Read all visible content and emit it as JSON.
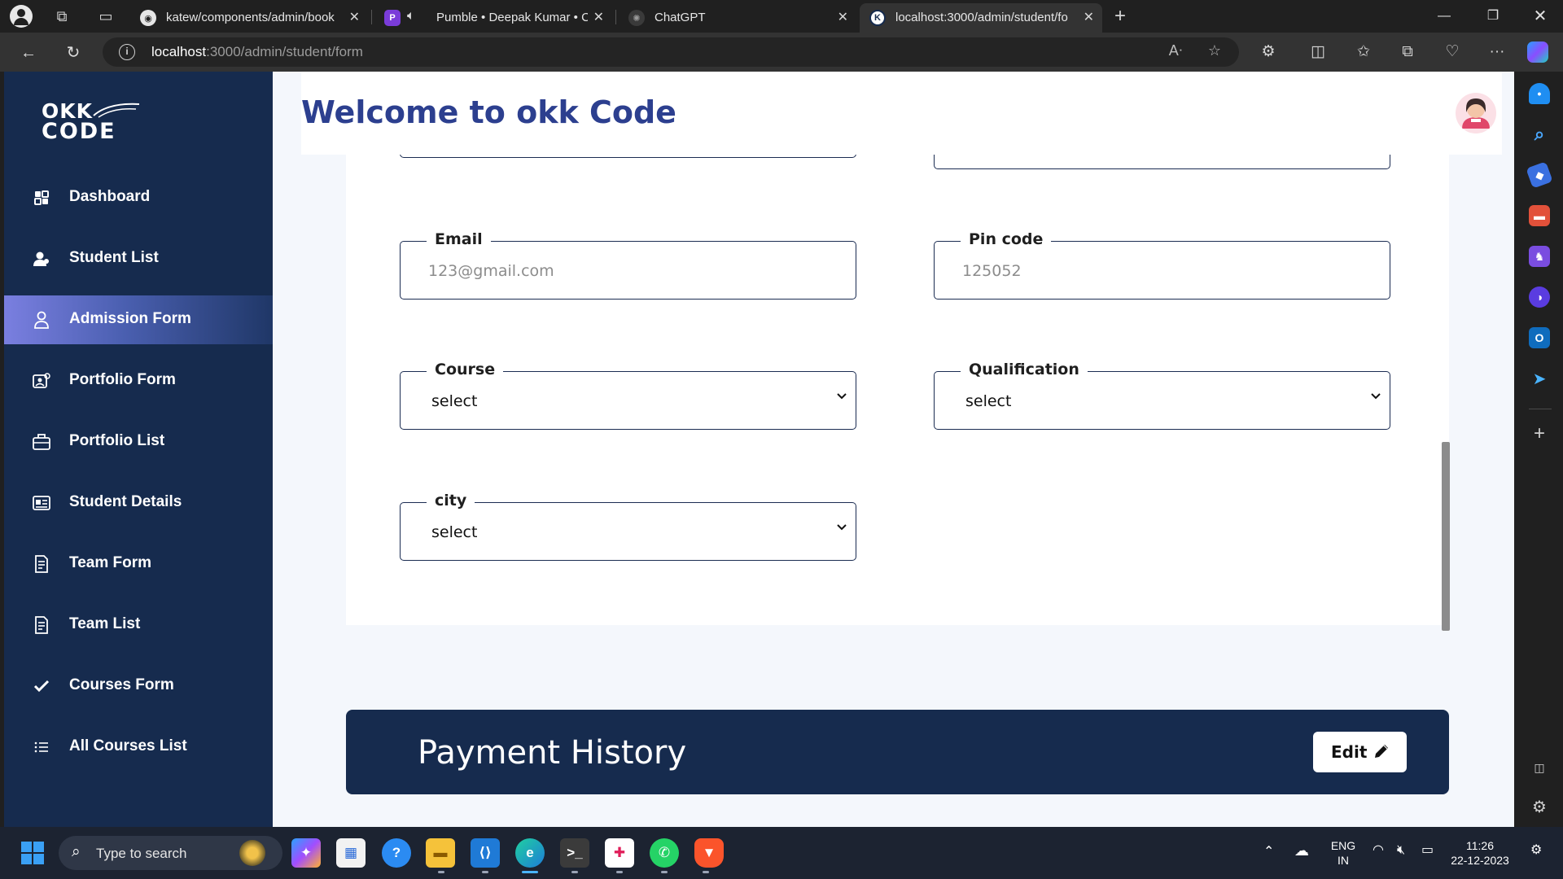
{
  "browser": {
    "tabs": [
      {
        "title": "katew/components/admin/book",
        "favicon": "github-icon",
        "active": false
      },
      {
        "title": "Pumble • Deepak Kumar • C",
        "favicon": "pumble-icon",
        "active": false,
        "audio": true
      },
      {
        "title": "ChatGPT",
        "favicon": "chatgpt-icon",
        "active": false
      },
      {
        "title": "localhost:3000/admin/student/fo",
        "favicon": "app-favicon",
        "active": true
      }
    ],
    "url_host": "localhost",
    "url_path": ":3000/admin/student/form"
  },
  "app": {
    "logo_line1": "OKK",
    "logo_line2": "CODE",
    "header_title": "Welcome to okk Code",
    "colors": {
      "sidebar": "#162b4e",
      "title": "#2c3f8f",
      "accent": "#7a7fe0"
    }
  },
  "sidebar": {
    "items": [
      {
        "label": "Dashboard",
        "icon": "grid-icon"
      },
      {
        "label": "Student List",
        "icon": "users-icon"
      },
      {
        "label": "Admission Form",
        "icon": "person-icon",
        "active": true
      },
      {
        "label": "Portfolio Form",
        "icon": "id-card-icon"
      },
      {
        "label": "Portfolio List",
        "icon": "briefcase-icon"
      },
      {
        "label": "Student Details",
        "icon": "contact-card-icon"
      },
      {
        "label": "Team Form",
        "icon": "document-icon"
      },
      {
        "label": "Team List",
        "icon": "document-icon"
      },
      {
        "label": "Courses Form",
        "icon": "check-icon"
      },
      {
        "label": "All Courses List",
        "icon": "list-icon"
      }
    ]
  },
  "form": {
    "email": {
      "label": "Email",
      "placeholder": "123@gmail.com"
    },
    "pincode": {
      "label": "Pin code",
      "placeholder": "125052"
    },
    "course": {
      "label": "Course",
      "selected": "select"
    },
    "qualification": {
      "label": "Qualification",
      "selected": "select"
    },
    "city": {
      "label": "city",
      "selected": "select"
    }
  },
  "payment": {
    "title": "Payment History",
    "edit_label": "Edit"
  },
  "taskbar": {
    "search_placeholder": "Type to search",
    "lang_top": "ENG",
    "lang_bottom": "IN",
    "time": "11:26",
    "date": "22-12-2023"
  }
}
